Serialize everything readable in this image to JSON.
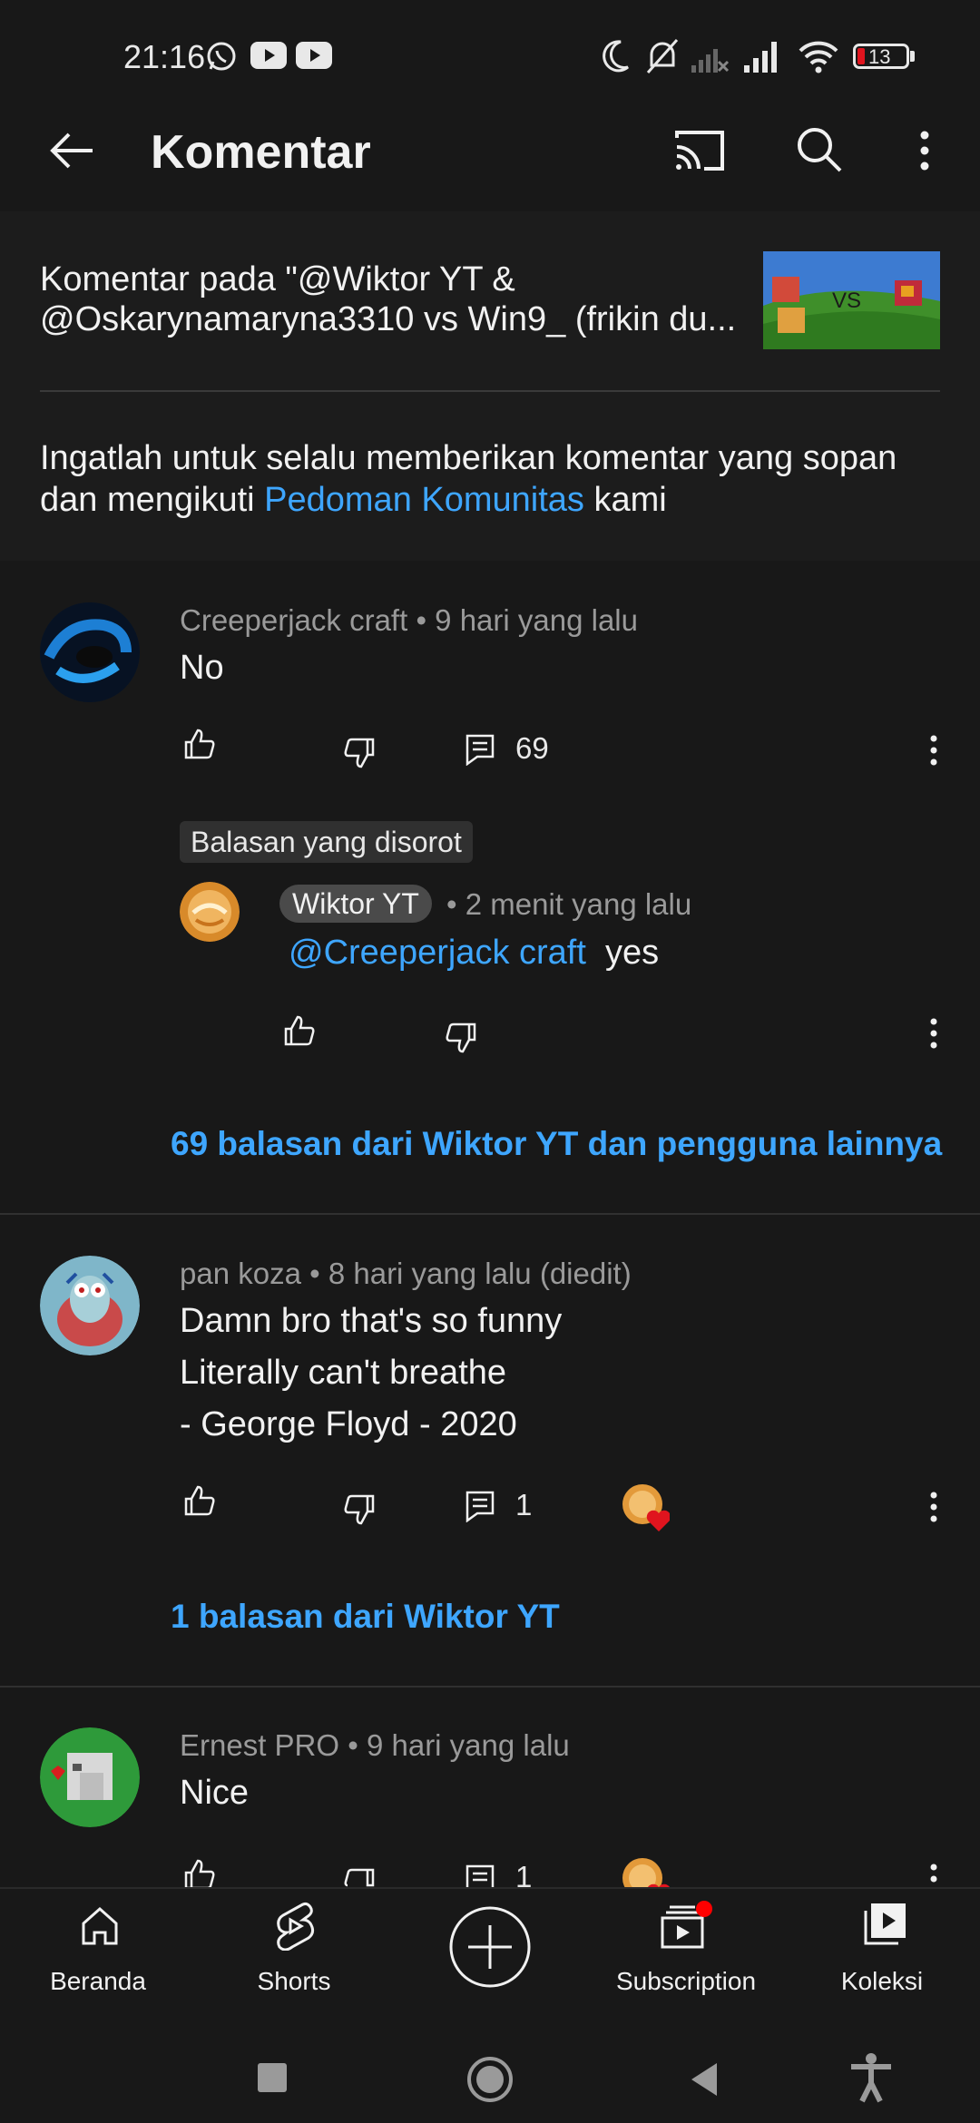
{
  "status_bar": {
    "time": "21:16",
    "battery": "13",
    "icons": [
      "whatsapp-icon",
      "youtube-icon",
      "youtube-icon",
      "moon-icon",
      "bell-off-icon",
      "signal-off-icon",
      "signal-icon",
      "wifi-icon",
      "battery-icon"
    ]
  },
  "header": {
    "title": "Komentar",
    "icons": [
      "back-arrow-icon",
      "cast-icon",
      "search-icon",
      "more-vertical-icon"
    ]
  },
  "video": {
    "title_line1": "Komentar pada \"@Wiktor YT &",
    "title_line2": "@Oskarynamaryna3310 vs Win9_ (frikin du...",
    "thumbnail_text": "VS"
  },
  "guideline": {
    "prefix": "Ingatlah untuk selalu memberikan komentar yang sopan dan mengikuti ",
    "link": "Pedoman Komunitas",
    "suffix": " kami"
  },
  "comments": [
    {
      "author": "Creeperjack craft",
      "time": "9 hari yang lalu",
      "text": "No",
      "reply_count": "69",
      "highlight_badge": "Balasan yang disorot",
      "highlighted_reply": {
        "author": "Wiktor YT",
        "time": "2 menit yang lalu",
        "mention": "@Creeperjack craft",
        "text": "yes"
      },
      "replies_link": "69 balasan dari Wiktor YT dan pengguna lainnya"
    },
    {
      "author": "pan koza",
      "time": "8 hari yang lalu (diedit)",
      "lines": [
        "Damn bro that's so funny",
        "Literally can't breathe",
        "- George Floyd - 2020"
      ],
      "reply_count": "1",
      "replies_link": "1 balasan dari Wiktor YT"
    },
    {
      "author": "Ernest PRO",
      "time": "9 hari yang lalu",
      "text": "Nice",
      "reply_count": "1"
    }
  ],
  "separator": "•",
  "bottom_nav": {
    "home": "Beranda",
    "shorts": "Shorts",
    "subscription": "Subscription",
    "library": "Koleksi"
  },
  "colors": {
    "background": "#181818",
    "link": "#3ea6ff",
    "secondary_text": "#9a9a9a",
    "notification_dot": "#ff0000",
    "heart": "#e0141e"
  }
}
